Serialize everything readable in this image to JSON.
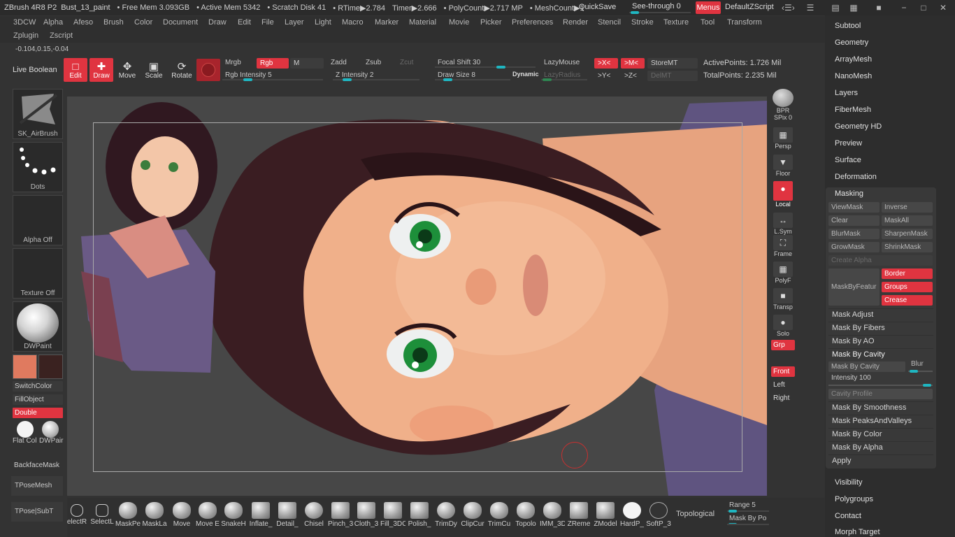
{
  "titlebar": {
    "app": "ZBrush 4R8 P2",
    "doc": "Bust_13_paint",
    "stats": [
      "• Free Mem 3.093GB",
      "• Active Mem 5342",
      "• Scratch Disk 41",
      "• RTime▶2.784",
      "Timer▶2.666",
      "• PolyCount▶2.717 MP",
      "• MeshCount▶1"
    ],
    "quicksave": "QuickSave",
    "see_through": "See-through  0",
    "menus": "Menus",
    "default_script": "DefaultZScript"
  },
  "menubar": {
    "row1": [
      "3DCW",
      "Alpha",
      "Afeso",
      "Brush",
      "Color",
      "Document",
      "Draw",
      "Edit",
      "File",
      "Layer",
      "Light",
      "Macro",
      "Marker",
      "Material",
      "Movie",
      "Picker",
      "Preferences",
      "Render",
      "Stencil",
      "Stroke",
      "Texture",
      "Tool",
      "Transform"
    ],
    "row2": [
      "Zplugin",
      "Zscript"
    ],
    "coords": "-0.104,0.15,-0.04"
  },
  "toolbar": {
    "live_boolean": "Live Boolean",
    "edit": "Edit",
    "draw": "Draw",
    "move": "Move",
    "scale": "Scale",
    "rotate": "Rotate",
    "mrgb": "Mrgb",
    "rgb": "Rgb",
    "m": "M",
    "rgb_intensity": "Rgb Intensity 5",
    "zadd": "Zadd",
    "zsub": "Zsub",
    "zcut": "Zcut",
    "z_intensity": "Z Intensity 2",
    "focal_shift": "Focal Shift 30",
    "draw_size": "Draw Size 8",
    "dynamic": "Dynamic",
    "lazymouse": "LazyMouse",
    "lazyradius": "LazyRadius",
    "x_sym": ">X<",
    "m_sym": ">M<",
    "y_sym": ">Y<",
    "z_sym": ">Z<",
    "storemt": "StoreMT",
    "delmt": "DelMT",
    "active_points": "ActivePoints: 1.726 Mil",
    "total_points": "TotalPoints: 2.235 Mil"
  },
  "left_shelf": {
    "brush": "SK_AirBrush",
    "stroke": "Dots",
    "alpha": "Alpha Off",
    "texture": "Texture Off",
    "material": "DWPaint",
    "switch_color": "SwitchColor",
    "fill_object": "FillObject",
    "double": "Double",
    "flat_color": "Flat Col",
    "dwpaint2": "DWPair",
    "backface": "BackfaceMask",
    "tpose_mesh": "TPoseMesh",
    "tpose_subt": "TPose|SubT",
    "colors": {
      "main": "#e07a5f",
      "secondary": "#3a2220"
    }
  },
  "right_shelf": {
    "bpr": "BPR",
    "spix": "SPix 0",
    "persp": "Persp",
    "floor": "Floor",
    "local": "Local",
    "lsym": "L.Sym",
    "frame": "Frame",
    "polyf": "PolyF",
    "transp": "Transp",
    "solo": "Solo",
    "grp": "Grp",
    "front": "Front",
    "left": "Left",
    "right": "Right"
  },
  "tool_panel": {
    "sections_top": [
      "Subtool",
      "Geometry",
      "ArrayMesh",
      "NanoMesh",
      "Layers",
      "FiberMesh",
      "Geometry HD",
      "Preview",
      "Surface",
      "Deformation"
    ],
    "masking": {
      "title": "Masking",
      "viewmask": "ViewMask",
      "inverse": "Inverse",
      "clear": "Clear",
      "maskall": "MaskAll",
      "blurmask": "BlurMask",
      "sharpenmask": "SharpenMask",
      "growmask": "GrowMask",
      "shrinkmask": "ShrinkMask",
      "create_alpha": "Create Alpha",
      "maskbyfeature": "MaskByFeatur",
      "border": "Border",
      "groups": "Groups",
      "crease": "Crease",
      "rows": [
        "Mask Adjust",
        "Mask By Fibers",
        "Mask By AO",
        "Mask By Cavity"
      ],
      "cavity_btn": "Mask By Cavity",
      "blur": "Blur",
      "intensity": "Intensity 100",
      "cavity_profile": "Cavity Profile",
      "rows2": [
        "Mask By Smoothness",
        "Mask PeaksAndValleys",
        "Mask By Color",
        "Mask By Alpha",
        "Apply"
      ]
    },
    "sections_bottom": [
      "Visibility",
      "Polygroups",
      "Contact",
      "Morph Target"
    ]
  },
  "bottom_shelf": {
    "brushes": [
      "electR",
      "SelectL",
      "MaskPe",
      "MaskLa",
      "Move",
      "Move E",
      "SnakeH",
      "Inflate_",
      "Detail_",
      "Chisel",
      "Pinch_3",
      "Cloth_3",
      "Fill_3DC",
      "Polish_",
      "TrimDy",
      "ClipCur",
      "TrimCu",
      "Topolo",
      "IMM_3D",
      "ZReme",
      "ZModel",
      "HardP_",
      "SoftP_3"
    ],
    "topological": "Topological",
    "range": "Range 5",
    "mask_by_po": "Mask By Po"
  }
}
